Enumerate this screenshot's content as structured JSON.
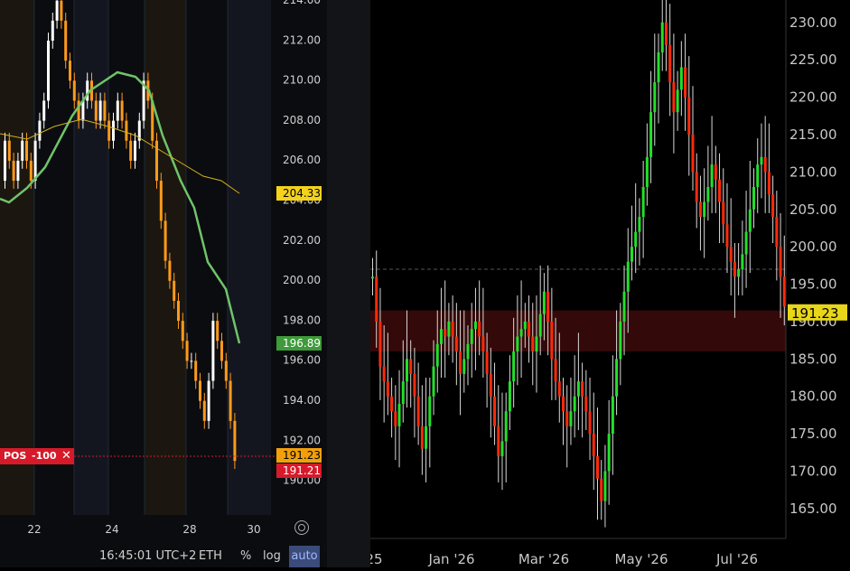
{
  "left_chart": {
    "y_ticks": [
      "214.00",
      "212.00",
      "210.00",
      "208.00",
      "206.00",
      "204.00",
      "202.00",
      "200.00",
      "198.00",
      "196.00",
      "194.00",
      "192.00",
      "190.00"
    ],
    "x_ticks": [
      "22",
      "24",
      "28",
      "30"
    ],
    "price_label": "191.23",
    "bid_label": "191.21",
    "ma_fast_label": "196.89",
    "ma_slow_label": "204.33",
    "position": {
      "tag": "POS",
      "qty": "-100",
      "close_icon": "close-icon"
    },
    "colors": {
      "up": "#ffffff",
      "down": "#ff9a1a",
      "ma_fast": "#6fc46a",
      "ma_slow": "#d2b21a",
      "short": "#d61a2a"
    }
  },
  "footer": {
    "time": "16:45:01 UTC+2",
    "symbol": "ETH",
    "percent": "%",
    "log": "log",
    "auto": "auto"
  },
  "chart_data": {
    "type": "line",
    "title": "",
    "x_ticks": [
      "25",
      "Jan '26",
      "Mar '26",
      "May '26",
      "Jul '26"
    ],
    "y_ticks": [
      "165.00",
      "170.00",
      "175.00",
      "180.00",
      "185.00",
      "190.00",
      "195.00",
      "200.00",
      "205.00",
      "210.00",
      "215.00",
      "220.00",
      "225.00",
      "230.00"
    ],
    "ylim": [
      161,
      233
    ],
    "last_price": "191.23",
    "series": [
      {
        "values": [
          196,
          190,
          184,
          182,
          180,
          178,
          176,
          179,
          182,
          185,
          183,
          180,
          176,
          173,
          176,
          180,
          184,
          187,
          189,
          188,
          190,
          188,
          186,
          183,
          185,
          187,
          189,
          190,
          188,
          186,
          183,
          180,
          176,
          172,
          174,
          178,
          182,
          186,
          188,
          189,
          190,
          188,
          186,
          188,
          191,
          194,
          190,
          185,
          182,
          180,
          178,
          176,
          178,
          180,
          182,
          180,
          178,
          175,
          172,
          169,
          166,
          170,
          175,
          180,
          185,
          190,
          194,
          198,
          200,
          202,
          204,
          208,
          212,
          218,
          222,
          226,
          230,
          227,
          222,
          218,
          221,
          224,
          220,
          215,
          210,
          206,
          204,
          206,
          208,
          211,
          209,
          206,
          203,
          200,
          198,
          196,
          197,
          199,
          202,
          205,
          208,
          211,
          212,
          210,
          207,
          204,
          200,
          196,
          192
        ]
      }
    ],
    "colors": {
      "up": "#22e02a",
      "down": "#ff2a0a",
      "zone": "#3a0a0a"
    }
  }
}
